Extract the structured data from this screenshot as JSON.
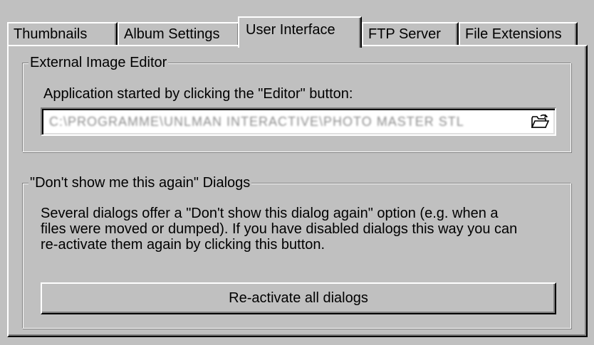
{
  "tabs": [
    {
      "label": "Thumbnails",
      "active": false
    },
    {
      "label": "Album Settings",
      "active": false
    },
    {
      "label": "User Interface",
      "active": true
    },
    {
      "label": "FTP Server",
      "active": false
    },
    {
      "label": "File Extensions",
      "active": false
    }
  ],
  "external_editor": {
    "group_title": "External Image Editor",
    "field_label": "Application started by clicking the \"Editor\" button:",
    "path_value": "C:\\PROGRAMME\\UNLMAN INTERACTIVE\\PHOTO MASTER STL",
    "browse_icon": "open-folder-icon"
  },
  "dialogs": {
    "group_title": "\"Don't show me this again\" Dialogs",
    "description_lines": [
      "Several dialogs offer a \"Don't show this dialog again\" option (e.g. when a",
      "files were moved or dumped). If you have disabled dialogs this way you can",
      "re-activate them again by clicking this button."
    ],
    "button_label": "Re-activate all dialogs"
  }
}
